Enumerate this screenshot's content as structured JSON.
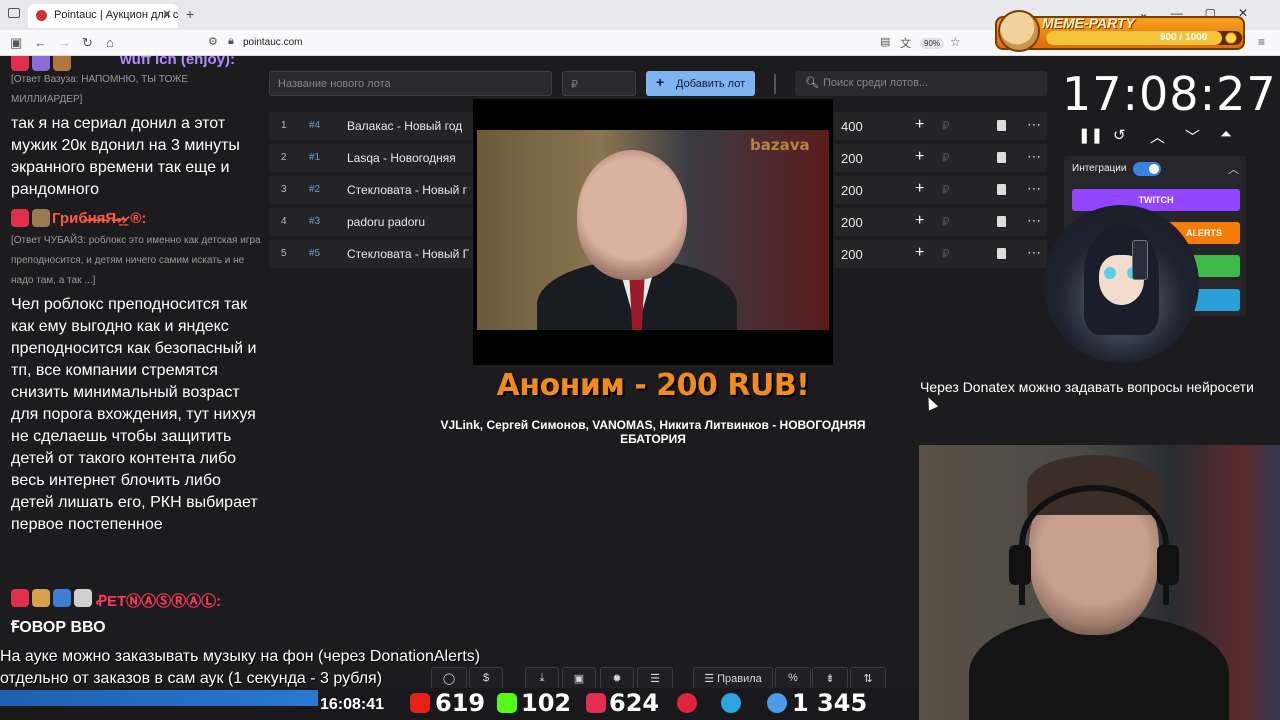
{
  "browser": {
    "tab_title": "Pointauc | Аукцион для стримеров",
    "url": "pointauc.com",
    "zoom": "90%"
  },
  "meme_party": {
    "title": "MEME-PARTY",
    "score": "900 / 1000",
    "progress": 0.9
  },
  "chat": {
    "messages": [
      {
        "user": "wuff ich (enjoy):",
        "reply": "[Ответ Вазуза: НАПОМНЮ, ТЫ ТОЖЕ МИЛЛИАРДЕР]",
        "text": "так я на сериал донил а этот мужик 20к вдонил на 3 минуты экранного времени так еще и рандомного"
      },
      {
        "user": "Гриб̶н̶я̶Я̶-̷̱-̷̱ ®:",
        "reply": "[Ответ ЧУБАЙЗ: роблокс это именно как детская игра преподносится, и детям ничего самим искать и не надо там, а так ...]",
        "text": "Чел роблокс преподносится так как ему выгодно как и яндекс преподносится как безопасный и тп, все компании стремятся снизить минимальный возраст для порога вхождения, тут нихуя не сделаешь чтобы защитить детей от такого контента либо весь интернет блочить либо детей лишать его, РКН выбирает первое постепенное"
      },
      {
        "user": "ꝒETⓃⒶⓈⓇⒶⓁ:",
        "reply": "",
        "text": "ꞘОВОР ВВО"
      }
    ]
  },
  "auction": {
    "lot_placeholder": "Название нового лота",
    "amount_placeholder": "₽",
    "add_lot_label": "Добавить лот",
    "search_placeholder": "Поиск среди лотов...",
    "lots": [
      {
        "num": "1",
        "fid": "#4",
        "name": "Валакас - Новый год",
        "amount": "400"
      },
      {
        "num": "2",
        "fid": "#1",
        "name": "Lasqa - Новогодняя",
        "amount": "200"
      },
      {
        "num": "3",
        "fid": "#2",
        "name": "Стекловата - Новый г",
        "amount": "200"
      },
      {
        "num": "4",
        "fid": "#3",
        "name": "padoru padoru",
        "amount": "200"
      },
      {
        "num": "5",
        "fid": "#5",
        "name": "Стекловата - Новый Г",
        "amount": "200"
      }
    ]
  },
  "video": {
    "watermark": "bazava"
  },
  "donation": {
    "title": "Аноним - 200 RUB!",
    "message": "VJLink, Сергей Симонов, VANOMAS, Никита Литвинков - НОВОГОДНЯЯ ЕБАТОРИЯ"
  },
  "timer": {
    "time": "17:08:27"
  },
  "integrations": {
    "label": "Интеграции",
    "twitch": "TWITCH",
    "alerts": "ALERTS"
  },
  "donatex_text": "Через Donatex можно задавать вопросы нейросети",
  "toolbar": {
    "rules": "Правила",
    "percent": "%"
  },
  "ticker": {
    "line1": "На ауке можно заказывать музыку на фон (через DonationAlerts)",
    "line2": "отдельно от заказов в сам аук (1 секунда - 3 рубля)"
  },
  "status": {
    "clock": "16:08:41",
    "youtube": "619",
    "kick": "102",
    "live": "624",
    "total": "1 345"
  },
  "colors": {
    "accent_blue": "#7fb4f0",
    "donor_orange": "#f28a1c",
    "twitch": "#9146ff",
    "alerts": "#f57d07"
  }
}
